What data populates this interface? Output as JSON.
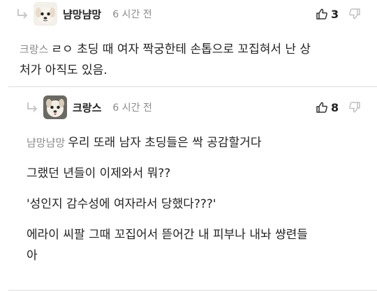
{
  "comment1": {
    "nickname": "냠망냠망",
    "time": "6 시간 전",
    "likes": "3",
    "mention": "크랑스",
    "text_line1": "ㄹㅇ 초딩 때 여자 짝궁한테 손톱으로 꼬집혀서 난 상",
    "text_line2": "처가 아직도 있음."
  },
  "comment2": {
    "nickname": "크랑스",
    "time": "6 시간 전",
    "likes": "8",
    "mention": "냠망냠망",
    "text_line1": "우리 또래 남자 초딩들은 싹 공감할거다",
    "para2": "그랬던 년들이 이제와서 뭐??",
    "para3": "'성인지 감수성에 여자라서 당했다???'",
    "para4_line1": "에라이 씨팔 그때 꼬집어서 뜯어간 내 피부나 내놔 썅련들",
    "para4_line2": "아"
  },
  "icons": {
    "reply": "reply-arrow-icon",
    "like": "thumbs-up-icon",
    "dislike": "thumbs-down-icon",
    "avatar1": "dog-avatar",
    "avatar2": "dog-avatar"
  },
  "colors": {
    "meta_gray": "#8a8a8a",
    "divider": "#dcdcdc",
    "text": "#222222"
  }
}
